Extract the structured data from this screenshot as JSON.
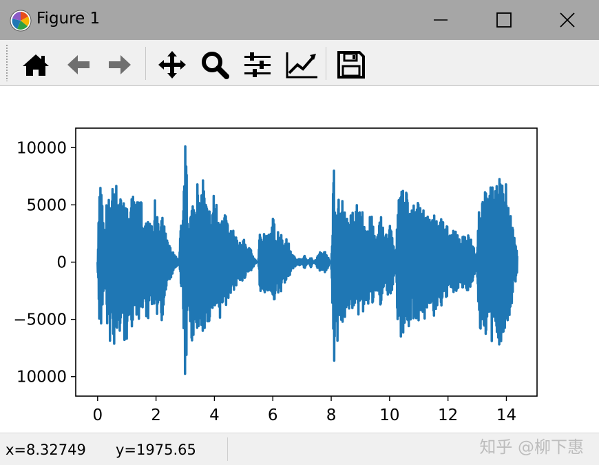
{
  "window": {
    "title": "Figure 1"
  },
  "toolbar": {
    "tools": [
      {
        "icon": "home-icon"
      },
      {
        "icon": "back-arrow-icon"
      },
      {
        "icon": "forward-arrow-icon"
      },
      {
        "icon": "pan-icon"
      },
      {
        "icon": "zoom-icon"
      },
      {
        "icon": "subplots-icon"
      },
      {
        "icon": "edit-axis-icon"
      },
      {
        "icon": "save-icon"
      }
    ]
  },
  "status": {
    "x_readout": "x=8.32749",
    "y_readout": "y=1975.65"
  },
  "watermark": "知乎 @柳下惠",
  "colors": {
    "line": "#1f77b4",
    "titlebar": "#a6a6a6",
    "toolbar": "#f0f0f0"
  },
  "chart_data": {
    "type": "line",
    "title": "",
    "xlabel": "",
    "ylabel": "",
    "xlim": [
      -0.75,
      15.05
    ],
    "ylim": [
      -11700,
      11700
    ],
    "xticks": [
      0,
      2,
      4,
      6,
      8,
      10,
      12,
      14
    ],
    "xtick_labels": [
      "0",
      "2",
      "4",
      "6",
      "8",
      "10",
      "12",
      "14"
    ],
    "yticks": [
      10000,
      5000,
      0,
      -5000,
      -10000
    ],
    "ytick_labels": [
      "10000",
      "5000",
      "0",
      "−5000",
      "10000"
    ],
    "grid": false,
    "series": [
      {
        "color": "#1f77b4",
        "envelope": {
          "x": [
            0.0,
            0.05,
            0.12,
            0.18,
            0.25,
            0.32,
            0.4,
            0.48,
            0.56,
            0.64,
            0.72,
            0.8,
            0.9,
            1.0,
            1.1,
            1.2,
            1.3,
            1.4,
            1.5,
            1.6,
            1.7,
            1.8,
            1.9,
            2.0,
            2.1,
            2.2,
            2.3,
            2.4,
            2.5,
            2.6,
            2.7,
            2.8,
            2.85,
            2.9,
            2.95,
            3.0,
            3.05,
            3.1,
            3.2,
            3.3,
            3.4,
            3.5,
            3.6,
            3.7,
            3.8,
            3.9,
            4.0,
            4.1,
            4.2,
            4.3,
            4.4,
            4.5,
            4.6,
            4.7,
            4.8,
            4.9,
            5.0,
            5.1,
            5.2,
            5.3,
            5.4,
            5.45,
            5.5,
            5.55,
            5.6,
            5.7,
            5.8,
            5.9,
            6.0,
            6.1,
            6.2,
            6.3,
            6.4,
            6.5,
            6.6,
            6.7,
            6.8,
            6.9,
            7.0,
            7.1,
            7.2,
            7.3,
            7.4,
            7.5,
            7.6,
            7.7,
            7.8,
            7.9,
            7.95,
            8.0,
            8.05,
            8.1,
            8.15,
            8.2,
            8.3,
            8.4,
            8.5,
            8.6,
            8.7,
            8.8,
            8.9,
            9.0,
            9.1,
            9.2,
            9.3,
            9.4,
            9.5,
            9.6,
            9.7,
            9.8,
            9.9,
            10.0,
            10.1,
            10.15,
            10.2,
            10.25,
            10.3,
            10.4,
            10.5,
            10.6,
            10.7,
            10.8,
            10.9,
            11.0,
            11.1,
            11.2,
            11.3,
            11.4,
            11.5,
            11.6,
            11.7,
            11.8,
            11.9,
            12.0,
            12.1,
            12.2,
            12.3,
            12.4,
            12.5,
            12.6,
            12.7,
            12.8,
            12.9,
            12.95,
            13.0,
            13.05,
            13.1,
            13.2,
            13.3,
            13.4,
            13.5,
            13.6,
            13.7,
            13.8,
            13.9,
            14.0,
            14.1,
            14.2,
            14.3,
            14.37
          ],
          "ymax": [
            0,
            6500,
            7800,
            3800,
            2500,
            6000,
            5700,
            7400,
            5800,
            7700,
            4200,
            6400,
            5500,
            6600,
            3800,
            6400,
            4700,
            6100,
            6200,
            2400,
            5200,
            3100,
            4000,
            6200,
            2500,
            4200,
            3000,
            1800,
            1300,
            800,
            400,
            200,
            4000,
            2000,
            6500,
            10500,
            7800,
            3500,
            5000,
            6000,
            8000,
            4500,
            8000,
            5500,
            5000,
            4500,
            6500,
            5000,
            5500,
            3500,
            4500,
            3000,
            3000,
            2500,
            2500,
            1500,
            2500,
            1000,
            1500,
            700,
            200,
            0,
            0,
            2500,
            3000,
            3000,
            2500,
            2500,
            4000,
            3000,
            3000,
            2500,
            1800,
            2200,
            1000,
            600,
            300,
            300,
            200,
            600,
            0,
            500,
            0,
            300,
            1000,
            700,
            1000,
            400,
            0,
            0,
            5000,
            10700,
            4000,
            7000,
            4500,
            6000,
            3500,
            4500,
            5500,
            3500,
            5500,
            4000,
            5000,
            3500,
            4000,
            4000,
            2500,
            2500,
            4500,
            2800,
            2500,
            3500,
            2500,
            1500,
            400,
            3500,
            7500,
            6500,
            6000,
            6500,
            5500,
            5000,
            5000,
            5500,
            4000,
            5000,
            4500,
            4500,
            5000,
            4500,
            3500,
            4000,
            3500,
            3000,
            2500,
            3000,
            2500,
            2000,
            2500,
            2500,
            2500,
            2000,
            1500,
            400,
            1000,
            4500,
            6500,
            5500,
            6500,
            5500,
            7500,
            6000,
            7000,
            7500,
            6500,
            7000,
            5000,
            3500,
            2000,
            800,
            0
          ],
          "ymin": [
            0,
            -5800,
            -6600,
            -3600,
            -2000,
            -5600,
            -7700,
            -6000,
            -9200,
            -6000,
            -7700,
            -4800,
            -7400,
            -6800,
            -4600,
            -6200,
            -4400,
            -5000,
            -5900,
            -3200,
            -5900,
            -3300,
            -4000,
            -5700,
            -3000,
            -5200,
            -3200,
            -2000,
            -1500,
            -800,
            -400,
            -200,
            -3000,
            -2000,
            -6500,
            -10600,
            -8500,
            -4500,
            -6500,
            -8000,
            -6500,
            -5500,
            -6500,
            -5500,
            -6000,
            -4500,
            -5000,
            -4500,
            -5500,
            -3500,
            -4000,
            -3000,
            -2500,
            -2500,
            -2000,
            -1500,
            -2000,
            -1000,
            -1000,
            -500,
            -200,
            0,
            0,
            -2500,
            -3000,
            -3000,
            -2500,
            -2500,
            -4000,
            -3000,
            -3000,
            -2500,
            -1800,
            -2200,
            -1000,
            -600,
            -300,
            -300,
            -200,
            -600,
            0,
            -500,
            0,
            -300,
            -1000,
            -700,
            -1000,
            -400,
            0,
            0,
            -5000,
            -10200,
            -4000,
            -7500,
            -4500,
            -6500,
            -4500,
            -4000,
            -5500,
            -3500,
            -5500,
            -4000,
            -5000,
            -3500,
            -4000,
            -4000,
            -2500,
            -2500,
            -4500,
            -2800,
            -2500,
            -3500,
            -2500,
            -1500,
            -400,
            -3500,
            -7500,
            -6500,
            -6000,
            -6500,
            -5500,
            -5000,
            -5000,
            -5500,
            -4000,
            -5000,
            -4500,
            -4500,
            -5000,
            -4500,
            -3500,
            -4000,
            -3500,
            -3000,
            -2500,
            -3000,
            -2500,
            -2000,
            -2500,
            -2500,
            -2500,
            -2000,
            -1500,
            -400,
            -1000,
            -4500,
            -6500,
            -5500,
            -6500,
            -5500,
            -7500,
            -6000,
            -7000,
            -7500,
            -6500,
            -7000,
            -5000,
            -3500,
            -2000,
            -800,
            0
          ]
        }
      }
    ]
  }
}
